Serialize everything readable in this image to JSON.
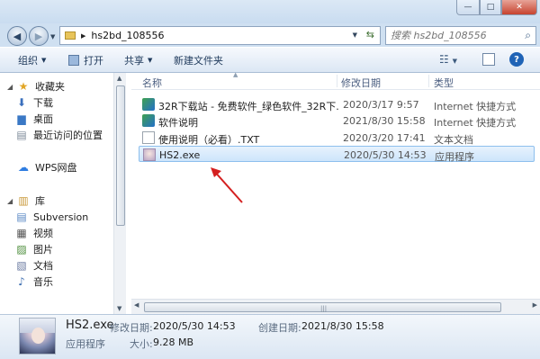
{
  "window": {
    "min_glyph": "—",
    "max_glyph": "□",
    "close_glyph": "✕"
  },
  "address": {
    "path": "hs2bd_108556"
  },
  "search": {
    "placeholder": "搜索 hs2bd_108556"
  },
  "toolbar": {
    "organize": "组织",
    "open": "打开",
    "share": "共享",
    "new_folder": "新建文件夹"
  },
  "sidebar": {
    "favorites": "收藏夹",
    "downloads": "下载",
    "desktop": "桌面",
    "recent": "最近访问的位置",
    "wps": "WPS网盘",
    "library": "库",
    "subversion": "Subversion",
    "videos": "视频",
    "pictures": "图片",
    "documents": "文档",
    "music": "音乐"
  },
  "columns": {
    "name": "名称",
    "date": "修改日期",
    "type": "类型"
  },
  "files": [
    {
      "name": "32R下载站 - 免费软件_绿色软件_32R下...",
      "date": "2020/3/17 9:57",
      "type": "Internet 快捷方式",
      "icon": "url-shortcut-icon"
    },
    {
      "name": "软件说明",
      "date": "2021/8/30 15:58",
      "type": "Internet 快捷方式",
      "icon": "url-shortcut-icon"
    },
    {
      "name": "使用说明（必看）.TXT",
      "date": "2020/3/20 17:41",
      "type": "文本文档",
      "icon": "text-file-icon"
    },
    {
      "name": "HS2.exe",
      "date": "2020/5/30 14:53",
      "type": "应用程序",
      "icon": "exe-icon"
    }
  ],
  "details": {
    "name": "HS2.exe",
    "modified_label": "修改日期:",
    "modified_value": "2020/5/30 14:53",
    "created_label": "创建日期:",
    "created_value": "2021/8/30 15:58",
    "kind": "应用程序",
    "size_label": "大小:",
    "size_value": "9.28 MB"
  },
  "colors": {
    "selection": "#cde5fb",
    "annotation_arrow": "#d42020"
  }
}
